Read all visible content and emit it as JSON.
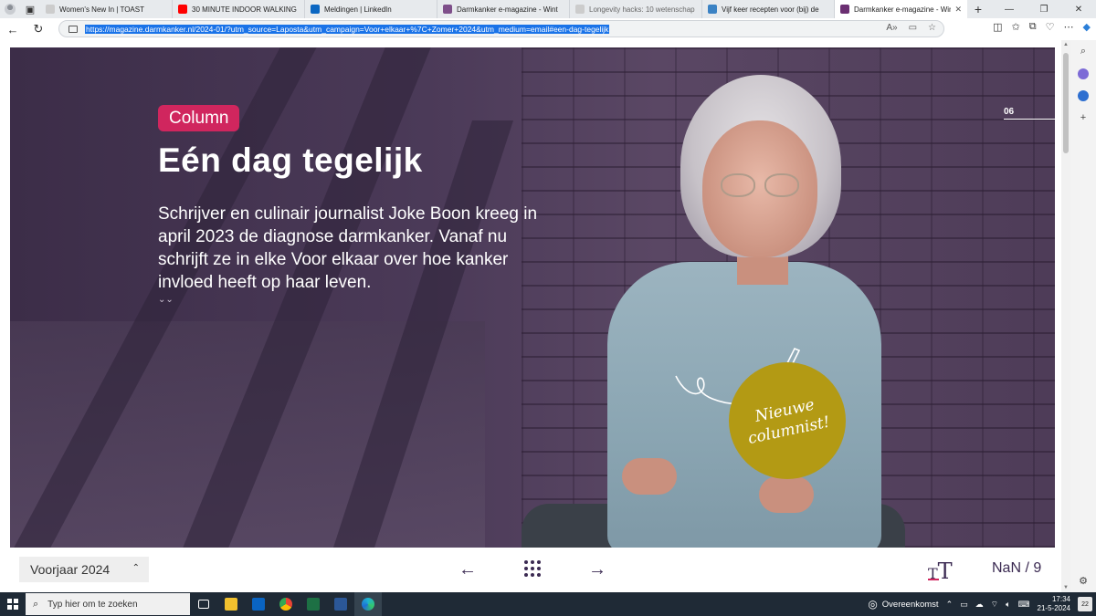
{
  "browser": {
    "tabs": [
      {
        "title": "Women's New In | TOAST",
        "favicon_color": "#cccccc",
        "favicon_icon": "toast-icon"
      },
      {
        "title": "30 MINUTE INDOOR WALKING",
        "favicon_color": "#ff0000",
        "favicon_icon": "youtube-icon"
      },
      {
        "title": "Meldingen | LinkedIn",
        "favicon_color": "#0a66c2",
        "favicon_icon": "linkedin-icon"
      },
      {
        "title": "Darmkanker e-magazine - Wint",
        "favicon_color": "#7e4f8a",
        "favicon_icon": "darmkanker-icon"
      },
      {
        "title": "Longevity hacks: 10 wetenschap",
        "favicon_color": "#cccccc",
        "favicon_icon": "page-icon"
      },
      {
        "title": "Vijf keer recepten voor (bij) de",
        "favicon_color": "#3b82c4",
        "favicon_icon": "t-icon"
      },
      {
        "title": "Darmkanker e-magazine - Wint",
        "favicon_color": "#6b2f72",
        "favicon_icon": "darmkanker-icon",
        "active": true
      }
    ],
    "new_tab_symbol": "+",
    "window_controls": {
      "minimize": "—",
      "maximize": "❐",
      "close": "✕"
    },
    "url": "https://magazine.darmkanker.nl/2024-01/?utm_source=Laposta&utm_campaign=Voor+elkaar+%7C+Zomer+2024&utm_medium=email#een-dag-tegelijk",
    "back_symbol": "←",
    "reload_symbol": "↻",
    "selection_color": "#1a73e8"
  },
  "page": {
    "badge": "Column",
    "badge_color": "#d0265e",
    "title": "Eén dag tegelijk",
    "intro": "Schrijver en culinair journalist Joke Boon kreeg in april 2023 de diagnose darmkanker. Vanaf nu schrijft ze in elke Voor elkaar over hoe kanker invloed heeft op haar leven.",
    "scroll_hint": "⌄⌄",
    "page_number": "06",
    "stamp_text_line1": "Nieuwe",
    "stamp_text_line2": "columnist!",
    "stamp_color": "#b39a14"
  },
  "bottom_nav": {
    "issue": "Voorjaar 2024",
    "issue_caret": "⌃",
    "prev_arrow": "←",
    "next_arrow": "→",
    "text_size_small": "T",
    "text_size_big": "T",
    "pager": "NaN / 9",
    "accent_color": "#3b2a52"
  },
  "taskbar": {
    "search_placeholder": "Typ hier om te zoeken",
    "weather": "Overeenkomst",
    "time": "17:34",
    "date": "21-5-2024",
    "notifications": "22"
  }
}
